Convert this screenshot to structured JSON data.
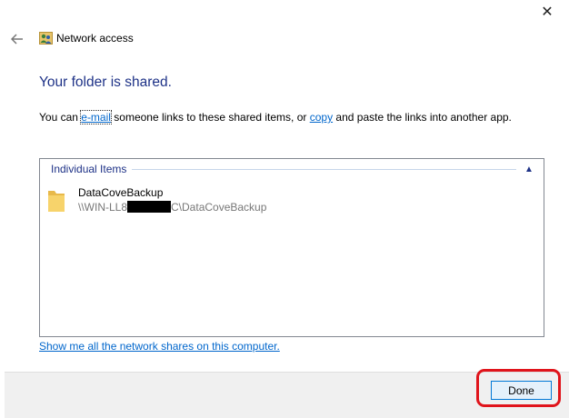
{
  "window": {
    "title": "Network access",
    "close_icon": "close-icon",
    "back_icon": "back-arrow-icon"
  },
  "main": {
    "headline": "Your folder is shared.",
    "info": {
      "prefix": "You can ",
      "email_link": "e-mail",
      "middle": " someone links to these shared items, or ",
      "copy_link": "copy",
      "suffix": " and paste the links into another app."
    },
    "group": {
      "label": "Individual Items",
      "chevron_icon": "chevron-up-icon"
    },
    "items": [
      {
        "name": "DataCoveBackup",
        "path_start": "\\\\WIN-LL8",
        "path_end": "C\\DataCoveBackup",
        "icon": "folder-icon"
      }
    ],
    "shares_link": "Show me all the network shares on this computer."
  },
  "footer": {
    "done_label": "Done"
  },
  "colors": {
    "headline": "#1e3287",
    "link": "#0066cc",
    "highlight": "#e0141b"
  }
}
